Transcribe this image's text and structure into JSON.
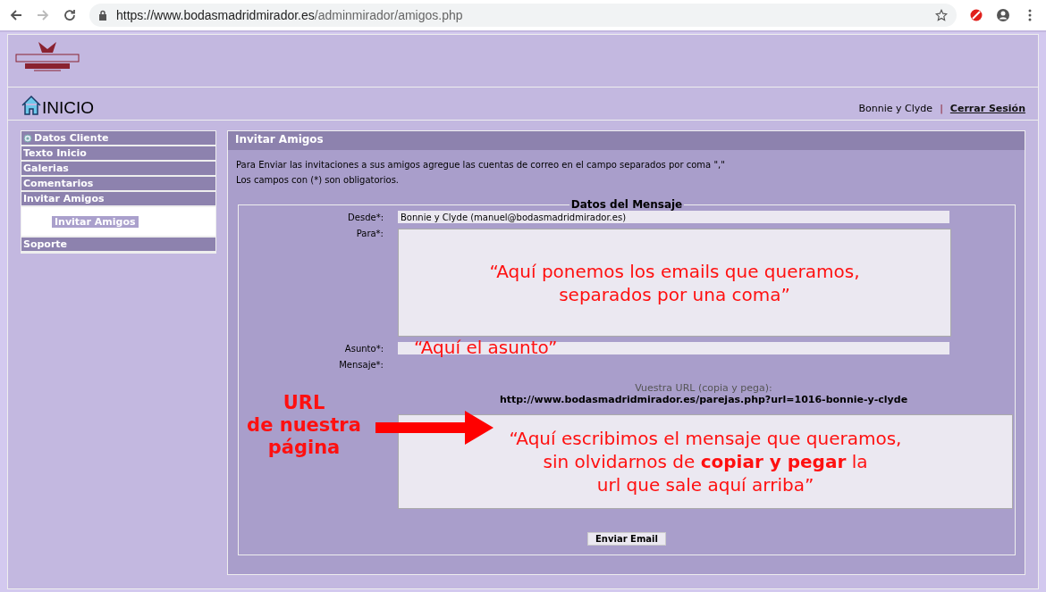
{
  "browser": {
    "url_host": "https://www.bodasmadridmirador.es",
    "url_path": "/adminmirador/amigos.php"
  },
  "header": {
    "home_label": "INICIO",
    "user": "Bonnie y Clyde",
    "separator": "|",
    "logout": "Cerrar Sesión"
  },
  "sidebar": {
    "items": [
      {
        "label": "Datos Cliente",
        "kind": "icon"
      },
      {
        "label": "Texto Inicio",
        "kind": "plain"
      },
      {
        "label": "Galerias",
        "kind": "plain"
      },
      {
        "label": "Comentarios",
        "kind": "plain"
      },
      {
        "label": "Invitar Amigos",
        "kind": "plain",
        "children": [
          {
            "label": "Invitar Amigos",
            "selected": true
          }
        ]
      },
      {
        "label": "Soporte",
        "kind": "plain"
      }
    ]
  },
  "panel": {
    "title": "Invitar Amigos",
    "intro": [
      "Para Enviar las invitaciones a sus amigos agregue las cuentas de correo en el campo separados por coma \",\"",
      "Los campos con (*) son obligatorios."
    ],
    "legend": "Datos del Mensaje",
    "desde": {
      "label": "Desde*:",
      "value": "Bonnie y Clyde (manuel@bodasmadridmirador.es)"
    },
    "para": {
      "label": "Para*:",
      "annotation": "“Aquí ponemos los emails que queramos,\nseparados por una coma”"
    },
    "asunto": {
      "label": "Asunto*:",
      "annotation": "“Aquí el asunto”"
    },
    "mensaje": {
      "label": "Mensaje*:",
      "url_label": "Vuestra URL (copia y pega):",
      "url": "http://www.bodasmadridmirador.es/parejas.php?url=1016-bonnie-y-clyde",
      "annotation": "“Aquí escribimos el mensaje que queramos,\nsin olvidarnos de **copiar y pegar** la\nurl que sale aquí arriba”"
    },
    "url_annotation": "URL\nde nuestra\npágina",
    "submit": "Enviar Email"
  }
}
